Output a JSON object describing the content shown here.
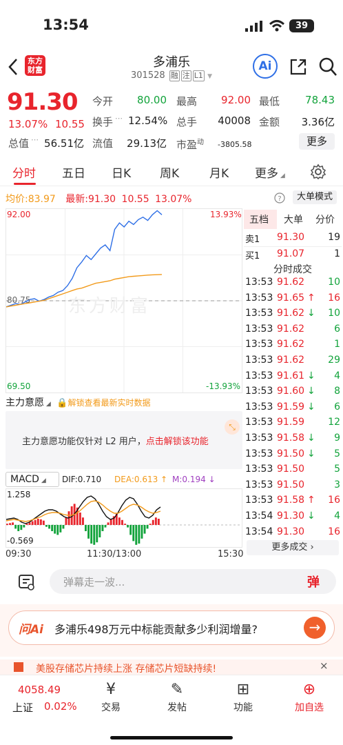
{
  "status": {
    "time": "13:54",
    "battery": "39"
  },
  "header": {
    "logo_line1": "东方",
    "logo_line2": "财富",
    "title": "多浦乐",
    "code": "301528",
    "tag1": "融",
    "tag2": "注",
    "tag3": "L1",
    "ai_label": "Ai"
  },
  "quote": {
    "price": "91.30",
    "pct": "13.07%",
    "chg": "10.55",
    "row1": [
      {
        "label": "今开",
        "value": "80.00",
        "color": "green"
      },
      {
        "label": "最高",
        "value": "92.00",
        "color": "red"
      },
      {
        "label": "最低",
        "value": "78.43",
        "color": "green"
      }
    ],
    "row2": [
      {
        "label": "换手",
        "value": "12.54%"
      },
      {
        "label": "总手",
        "value": "40008"
      },
      {
        "label": "金额",
        "value": "3.36亿"
      }
    ],
    "row3": [
      {
        "label": "总值",
        "value": "56.51亿"
      },
      {
        "label": "流值",
        "value": "29.13亿"
      },
      {
        "label": "市盈",
        "sup": "动",
        "value": "-3805.58"
      }
    ],
    "more": "更多"
  },
  "tabs": [
    "分时",
    "五日",
    "日K",
    "周K",
    "月K",
    "更多"
  ],
  "avgline": {
    "avg_label": "均价:",
    "avg": "83.97",
    "last_label": "最新:",
    "last": "91.30",
    "chg": "10.55",
    "pct": "13.07%"
  },
  "mode_button": "大单模式",
  "chart": {
    "ymax": "92.00",
    "ymin": "69.50",
    "ymid": "80.75",
    "pct_max": "13.93%",
    "pct_min": "-13.93%",
    "watermark": "东方财富"
  },
  "chart_data": {
    "type": "line",
    "ylim": [
      69.5,
      92.0
    ],
    "series": [
      {
        "values": [
          80.0,
          80.2,
          80.4,
          80.3,
          80.6,
          80.9,
          81.0,
          80.7,
          80.9,
          81.2,
          81.4,
          81.8,
          82.0,
          82.6,
          83.5,
          84.8,
          85.5,
          86.3,
          85.8,
          86.5,
          87.2,
          87.6,
          86.9,
          89.5,
          90.3,
          89.8,
          90.5,
          90.1,
          90.7,
          91.0,
          90.6,
          91.3,
          91.8,
          91.3
        ]
      },
      {
        "values": [
          80.0,
          80.1,
          80.2,
          80.3,
          80.4,
          80.5,
          80.6,
          80.7,
          80.8,
          81.0,
          81.2,
          81.4,
          81.6,
          81.8,
          82.0,
          82.2,
          82.3,
          82.5,
          82.7,
          82.9,
          83.0,
          83.1,
          83.2,
          83.4,
          83.5,
          83.6,
          83.7,
          83.75,
          83.8,
          83.85,
          83.9,
          83.93,
          83.95,
          83.97
        ]
      }
    ]
  },
  "orderbook": {
    "tabs": [
      "五档",
      "大单",
      "分价"
    ],
    "sell": {
      "label": "卖1",
      "price": "91.30",
      "vol": "19"
    },
    "buy": {
      "label": "买1",
      "price": "91.07",
      "vol": "1"
    },
    "trades_title": "分时成交"
  },
  "trades": [
    {
      "t": "13:53",
      "p": "91.62",
      "a": "",
      "v": "10",
      "c": "green"
    },
    {
      "t": "13:53",
      "p": "91.65",
      "a": "↑",
      "v": "16",
      "c": "red"
    },
    {
      "t": "13:53",
      "p": "91.62",
      "a": "↓",
      "v": "10",
      "c": "green"
    },
    {
      "t": "13:53",
      "p": "91.62",
      "a": "",
      "v": "6",
      "c": "green"
    },
    {
      "t": "13:53",
      "p": "91.62",
      "a": "",
      "v": "1",
      "c": "green"
    },
    {
      "t": "13:53",
      "p": "91.62",
      "a": "",
      "v": "29",
      "c": "green"
    },
    {
      "t": "13:53",
      "p": "91.61",
      "a": "↓",
      "v": "4",
      "c": "green"
    },
    {
      "t": "13:53",
      "p": "91.60",
      "a": "↓",
      "v": "8",
      "c": "green"
    },
    {
      "t": "13:53",
      "p": "91.59",
      "a": "↓",
      "v": "6",
      "c": "green"
    },
    {
      "t": "13:53",
      "p": "91.59",
      "a": "",
      "v": "12",
      "c": "green"
    },
    {
      "t": "13:53",
      "p": "91.58",
      "a": "↓",
      "v": "9",
      "c": "green"
    },
    {
      "t": "13:53",
      "p": "91.50",
      "a": "↓",
      "v": "5",
      "c": "green"
    },
    {
      "t": "13:53",
      "p": "91.50",
      "a": "",
      "v": "5",
      "c": "green"
    },
    {
      "t": "13:53",
      "p": "91.50",
      "a": "",
      "v": "3",
      "c": "green"
    },
    {
      "t": "13:53",
      "p": "91.58",
      "a": "↑",
      "v": "16",
      "c": "red"
    },
    {
      "t": "13:54",
      "p": "91.30",
      "a": "↓",
      "v": "4",
      "c": "green"
    },
    {
      "t": "13:54",
      "p": "91.30",
      "a": "",
      "v": "16",
      "c": "red"
    }
  ],
  "more_trades": "更多成交",
  "intent": {
    "label": "主力意愿",
    "unlock": "解锁查看最新实时数据",
    "msg": "主力意愿功能仅针对 L2 用户，",
    "link": "点击解锁该功能"
  },
  "macd": {
    "label": "MACD",
    "dif": "DIF:0.710",
    "dea": "DEA:0.613",
    "m": "M:0.194",
    "top": "1.258",
    "bottom": "-0.569"
  },
  "time_axis": {
    "start": "09:30",
    "mid": "11:30/13:00",
    "end": "15:30"
  },
  "danmu": {
    "placeholder": "弹幕走一波...",
    "btn": "弹"
  },
  "ai_question": {
    "brand": "问Ai",
    "text": "多浦乐498万元中标能贡献多少利润增量?"
  },
  "banner": {
    "text": "美股存储芯片持续上涨 存储芯片短缺持续!"
  },
  "bottom": {
    "index_value": "4058.49",
    "index_name": "上证",
    "index_pct": "0.02%",
    "nav": [
      "交易",
      "发帖",
      "功能",
      "加自选"
    ]
  },
  "colors": {
    "red": "#e8242c",
    "green": "#12a33b",
    "blue": "#2e6fe6",
    "orange": "#f29a1a"
  }
}
